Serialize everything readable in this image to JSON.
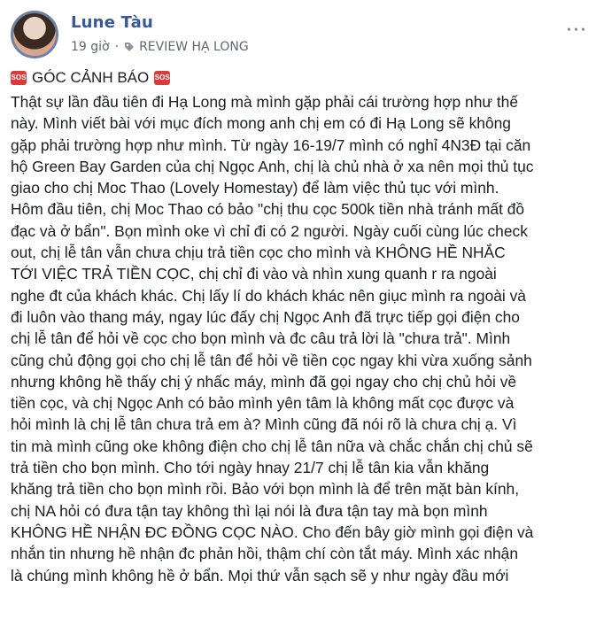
{
  "post": {
    "author": "Lune Tàu",
    "time": "19 giờ",
    "separator": "·",
    "tag": "REVIEW HẠ LONG",
    "more": "···",
    "title": "GÓC CẢNH BÁO",
    "sos_label": "SOS",
    "lines": [
      "Thật sự lần đầu tiên đi Hạ Long mà mình gặp phải cái trường hợp như thế",
      "này. Mình viết bài với mục đích mong anh chị em có đi Hạ Long sẽ không",
      "gặp phải trường hợp như mình. Từ ngày 16-19/7 mình có nghỉ 4N3Đ tại căn",
      "hộ Green Bay Garden của chị Ngọc Anh, chị là chủ nhà ở xa nên mọi thủ tục",
      "giao cho chị Moc Thao (Lovely Homestay) để làm việc thủ tục với mình.",
      "Hôm đầu tiên, chị Moc Thao có bảo \"chị thu cọc 500k tiền nhà tránh mất đồ",
      "đạc và ở bẩn\". Bọn mình oke vì chỉ đi có 2 người. Ngày cuối cùng lúc check",
      "out, chị lễ tân vẫn chưa chịu trả tiền cọc cho mình và KHÔNG HỀ NHẮC",
      "TỚI VIỆC TRẢ TIỀN CỌC, chị chỉ đi vào và nhìn xung quanh r ra ngoài",
      "nghe đt của khách khác. Chị lấy lí do khách khác nên giục mình ra ngoài và",
      "đi luôn vào thang máy, ngay lúc đấy chị Ngọc Anh đã trực tiếp gọi điện cho",
      "chị lễ tân để hỏi về cọc cho bọn mình và đc câu trả lời là \"chưa trả\". Mình",
      "cũng chủ động gọi cho chị lễ tân để hỏi về tiền cọc ngay khi vừa xuống sảnh",
      "nhưng không hề thấy chị ý nhấc máy, mình đã gọi ngay cho chị chủ hỏi về",
      "tiền cọc, và chị Ngọc Anh có bảo mình yên tâm là không mất cọc được và",
      "hỏi mình là chị lễ tân chưa trả em à? Mình cũng đã nói rõ là chưa chị ạ. Vì",
      "tin mà mình cũng oke không điện cho chị lễ tân nữa và chắc chắn chị chủ sẽ",
      "trả tiền cho bọn mình. Cho tới ngày hnay 21/7 chị lễ tân kia vẫn khăng",
      "khăng trả tiền cho bọn mình rồi. Bảo với bọn mình là để trên mặt bàn kính,",
      "chị NA hỏi có đưa tận tay không thì lại nói là đưa tận tay mà bọn mình",
      "KHÔNG HỀ NHẬN ĐC ĐỒNG CỌC NÀO. Cho đến bây giờ mình gọi điện và",
      "nhắn tin nhưng hề nhận đc phản hồi, thậm chí còn tắt máy. Mình xác nhận",
      "là chúng mình không hề ở bẩn. Mọi thứ vẫn sạch sẽ y như ngày đầu mới"
    ]
  },
  "colors": {
    "author": "#385898",
    "meta": "#606770",
    "sos": "#d93a3a"
  }
}
